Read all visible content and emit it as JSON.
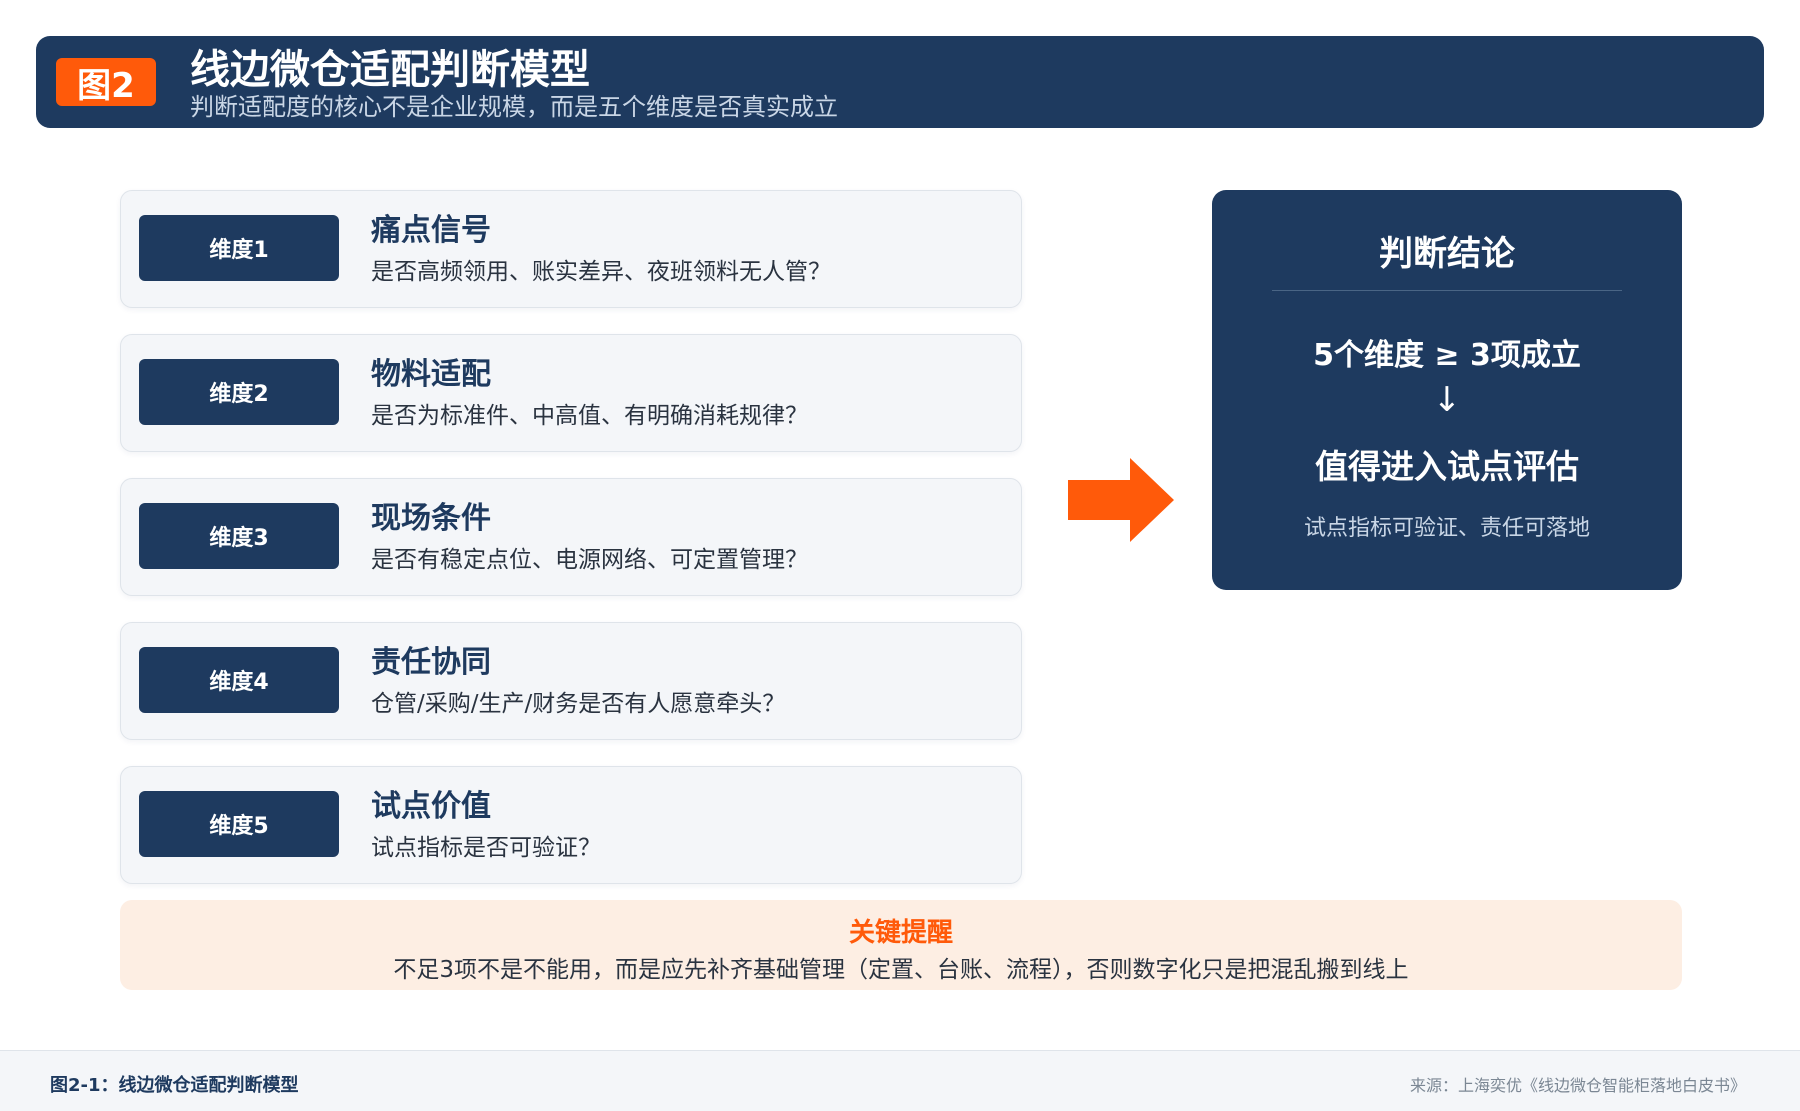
{
  "header": {
    "badge": "图2",
    "title": "线边微仓适配判断模型",
    "subtitle": "判断适配度的核心不是企业规模，而是五个维度是否真实成立"
  },
  "dimensions": [
    {
      "tag": "维度1",
      "title": "痛点信号",
      "question": "是否高频领用、账实差异、夜班领料无人管？"
    },
    {
      "tag": "维度2",
      "title": "物料适配",
      "question": "是否为标准件、中高值、有明确消耗规律？"
    },
    {
      "tag": "维度3",
      "title": "现场条件",
      "question": "是否有稳定点位、电源网络、可定置管理？"
    },
    {
      "tag": "维度4",
      "title": "责任协同",
      "question": "仓管/采购/生产/财务是否有人愿意牵头？"
    },
    {
      "tag": "维度5",
      "title": "试点价值",
      "question": "试点指标是否可验证？"
    }
  ],
  "conclusion": {
    "title": "判断结论",
    "rule": "5个维度 ≥ 3项成立",
    "arrow": "↓",
    "result": "值得进入试点评估",
    "note": "试点指标可验证、责任可落地"
  },
  "reminder": {
    "title": "关键提醒",
    "text": "不足3项不是不能用，而是应先补齐基础管理（定置、台账、流程），否则数字化只是把混乱搬到线上"
  },
  "footer": {
    "caption": "图2-1：线边微仓适配判断模型",
    "source": "来源：上海奕优《线边微仓智能柜落地白皮书》"
  },
  "colors": {
    "navy": "#1e3a5f",
    "accent_orange": "#ff5a0a",
    "reminder_bg": "#fdeee3",
    "card_bg": "#f4f6f9"
  }
}
